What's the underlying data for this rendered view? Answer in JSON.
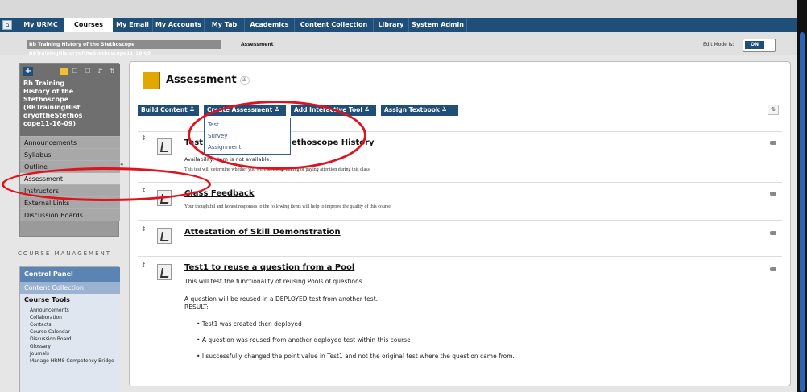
{
  "tabs": [
    "My URMC",
    "Courses",
    "My Email",
    "My Accounts",
    "My Tab",
    "Academics",
    "Content Collection",
    "Library",
    "System Admin"
  ],
  "breadcrumb": {
    "course": "Bb Training History of the Stethoscope BBTrainingHistoryoftheStethoscope11-16-09",
    "page": "Assessment"
  },
  "edit_mode": {
    "label": "Edit Mode is:",
    "value": "ON"
  },
  "course_menu": {
    "title": "Bb Training History of the Stethoscope (BBTrainingHistoryoftheStethoscope11-16-09)",
    "title_lines": [
      "Bb Training",
      "History of the",
      "Stethoscope",
      "(BBTrainingHist",
      "oryoftheStethos",
      "cope11-16-09)"
    ],
    "items": [
      "Announcements",
      "Syllabus",
      "Outline",
      "Assessment",
      "Instructors",
      "External Links",
      "Discussion Boards"
    ]
  },
  "course_management": {
    "title": "COURSE MANAGEMENT",
    "control_panel": "Control Panel",
    "content_collection": "Content Collection",
    "course_tools": "Course Tools",
    "tools": [
      "Announcements",
      "Collaboration",
      "Contacts",
      "Course Calendar",
      "Discussion Board",
      "Glossary",
      "Journals",
      "Manage HRMS Competency Bridge"
    ]
  },
  "page_title": "Assessment",
  "actions": [
    "Build Content",
    "Create Assessment",
    "Add Interactive Tool",
    "Assign Textbook"
  ],
  "dropdown_items": [
    "Test",
    "Survey",
    "Assignment"
  ],
  "items": [
    {
      "title": "Test 1 - History of the Stethoscope History",
      "visible_title": "Test",
      "title_tail": "ethoscope History",
      "avail": "Availability:  Item is not available.",
      "desc": "This test will determine whether you were sleeping, talking or paying attention during this class."
    },
    {
      "title": "Class Feedback",
      "desc": "Your thoughtful and honest responses to the following items will help to improve the quality of this course."
    },
    {
      "title": "Attestation of Skill Demonstration"
    },
    {
      "title": "Test1 to reuse a question from a Pool",
      "desc": "This will test the functionality of reusing Pools of questions",
      "body1": "A question will be reused in a DEPLOYED test from another test.",
      "body2": "RESULT:",
      "bullets": [
        "Test1 was created then deployed",
        "A question was reused from another deployed test within this course",
        "I successfully changed the point value in Test1 and not the original test where the question came from."
      ]
    }
  ],
  "colors": {
    "nav": "#1f4e79",
    "annotation": "#e0121e",
    "menu": "#9a9a9a"
  }
}
